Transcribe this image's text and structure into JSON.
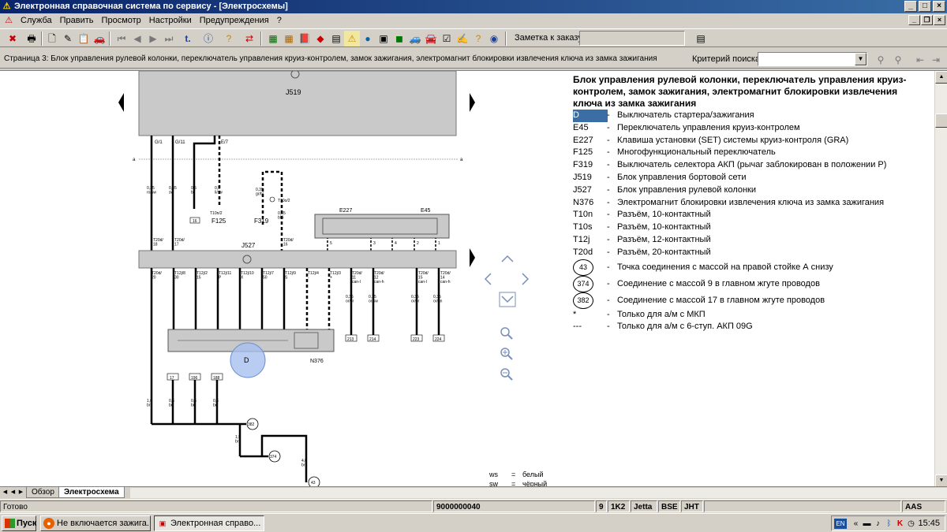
{
  "window": {
    "title": "Электронная справочная система по сервису - [Электросхемы]"
  },
  "menu": [
    "Служба",
    "Править",
    "Просмотр",
    "Настройки",
    "Предупреждения",
    "?"
  ],
  "toolbar": {
    "order_label": "Заметка к заказу:",
    "order_value": ""
  },
  "breadcrumb": {
    "page_text": "Страница 3: Блок управления рулевой колонки, переключатель управления круиз-контролем, замок зажигания, электромагнит блокировки извлечения ключа из замка зажигания",
    "search_label": "Критерий поиска:",
    "search_value": ""
  },
  "diagram": {
    "top_unit": "J519",
    "mid_unit": "J527",
    "switch_unit": "E227",
    "switch_unit2": "E45",
    "f125": "F125",
    "f319": "F319",
    "n376": "N376",
    "t10n2": "T10n/2",
    "t10o2": "T10o/2",
    "ignition_label": "D",
    "bus_label": "a",
    "top_pins": [
      "G/1",
      "G/11",
      "E/7"
    ],
    "top_wires": [
      "0,35\nro/sw",
      "0,35\nsw",
      "0,5\nbr",
      "0,5\nli/sw"
    ],
    "f319_wire": "0,35\ngr/bl",
    "t10_wire": "0,35\nbl/li",
    "t20_upper": [
      "T20d/\n18",
      "T20d/\n17",
      "T20d/\n16"
    ],
    "t20_lower": [
      "T20d/\n20",
      "T12j/8\n30",
      "T12j/2\n15",
      "T12j/11\nP",
      "T12j/10\nX",
      "T12j/7\n50",
      "T12j/9\nS",
      "T12j/4\n-",
      "T12j/3\n+",
      "T20d/\n11\ncan-l",
      "T20d/\n12\ncan-h",
      "T20d/\n15\ncan-l",
      "T20d/\n14\ncan-h"
    ],
    "e227_pins": [
      "5",
      "3",
      "4",
      "2",
      "1"
    ],
    "can_wires": [
      "0,35\nor/br",
      "0,35\nor/sw",
      "0,35\nor/br",
      "0,35\nor/gn"
    ],
    "can_boxes": [
      "213",
      "214",
      "223",
      "224"
    ],
    "lower_boxes": [
      "17",
      "196",
      "188"
    ],
    "lower_wires": [
      "1,0\nbr",
      "0,5\nbr",
      "0,5\nbr",
      "0,5\nbr"
    ],
    "ground_points": [
      "382",
      "374",
      "43"
    ],
    "ground_wires": [
      "1,5\nbr",
      "4,0\nbr"
    ],
    "color_key": [
      {
        "code": "ws",
        "eq": "=",
        "name": "белый"
      },
      {
        "code": "sw",
        "eq": "=",
        "name": "чёрный"
      }
    ]
  },
  "legend": {
    "title": "Блок управления рулевой колонки, переключатель управления круиз-контролем, замок зажигания, электромагнит блокировки извлечения ключа из замка зажигания",
    "items": [
      {
        "code": "D",
        "desc": "Выключатель стартера/зажигания",
        "selected": true
      },
      {
        "code": "E45",
        "desc": "Переключатель управления круиз-контролем"
      },
      {
        "code": "E227",
        "desc": "Клавиша установки (SET) системы круиз-контроля (GRA)"
      },
      {
        "code": "F125",
        "desc": "Многофункциональный переключатель"
      },
      {
        "code": "F319",
        "desc": "Выключатель селектора АКП (рычаг заблокирован в положении P)"
      },
      {
        "code": "J519",
        "desc": "Блок управления бортовой сети"
      },
      {
        "code": "J527",
        "desc": "Блок управления рулевой колонки"
      },
      {
        "code": "N376",
        "desc": "Электромагнит блокировки извлечения ключа из замка зажигания"
      },
      {
        "code": "T10n",
        "desc": "Разъём, 10-контактный"
      },
      {
        "code": "T10s",
        "desc": "Разъём, 10-контактный"
      },
      {
        "code": "T12j",
        "desc": "Разъём, 12-контактный"
      },
      {
        "code": "T20d",
        "desc": "Разъём, 20-контактный"
      }
    ],
    "circle_items": [
      {
        "code": "43",
        "desc": "Точка соединения с массой на правой стойке А снизу"
      },
      {
        "code": "374",
        "desc": "Соединение с массой 9 в главном жгуте проводов"
      },
      {
        "code": "382",
        "desc": "Соединение с массой 17 в главном жгуте проводов"
      }
    ],
    "notes": [
      {
        "code": "*",
        "desc": "Только для а/м с МКП"
      },
      {
        "code": "---",
        "desc": "Только для а/м с 6-ступ. АКП 09G"
      }
    ]
  },
  "tabs": [
    "Обзор",
    "Электросхема"
  ],
  "status": {
    "text": "Готово",
    "order_no": "9000000040",
    "n": "9",
    "code": "1K2",
    "model": "Jetta",
    "engine": "BSE",
    "gearbox": "JHT",
    "aas": "AAS"
  },
  "taskbar": {
    "start": "Пуск",
    "tasks": [
      "Не включается зажига...",
      "Электронная справо..."
    ],
    "lang": "EN",
    "time": "15:45"
  }
}
